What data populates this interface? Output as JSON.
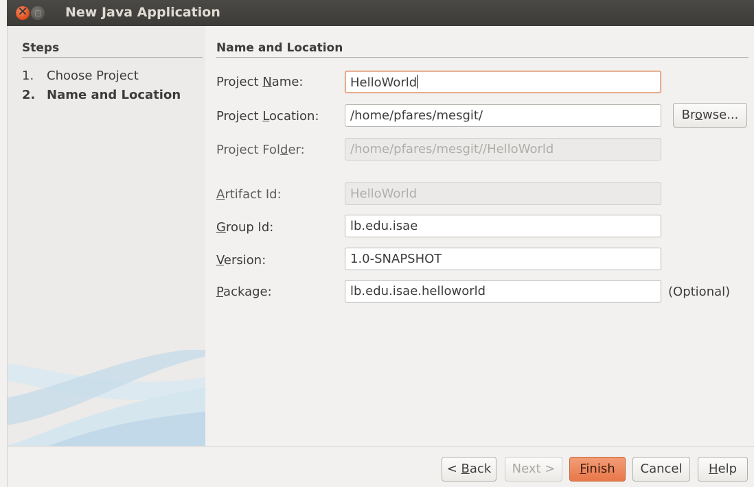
{
  "window": {
    "title": "New Java Application"
  },
  "steps": {
    "title": "Steps",
    "items": [
      {
        "num": "1.",
        "label": "Choose Project"
      },
      {
        "num": "2.",
        "label": "Name and Location"
      }
    ]
  },
  "section": {
    "title": "Name and Location"
  },
  "form": {
    "project_name": {
      "label_pre": "Project ",
      "label_key": "N",
      "label_post": "ame:",
      "value": "HelloWorld"
    },
    "project_location": {
      "label_pre": "Project ",
      "label_key": "L",
      "label_post": "ocation:",
      "value": "/home/pfares/mesgit/"
    },
    "project_folder": {
      "label_pre": "Project Fol",
      "label_key": "d",
      "label_post": "er:",
      "value": "/home/pfares/mesgit//HelloWorld"
    },
    "artifact_id": {
      "label_pre": "",
      "label_key": "A",
      "label_post": "rtifact Id:",
      "value": "HelloWorld"
    },
    "group_id": {
      "label_pre": "",
      "label_key": "G",
      "label_post": "roup Id:",
      "value": "lb.edu.isae"
    },
    "version": {
      "label_pre": "",
      "label_key": "V",
      "label_post": "ersion:",
      "value": "1.0-SNAPSHOT"
    },
    "package": {
      "label_pre": "",
      "label_key": "P",
      "label_post": "ackage:",
      "value": "lb.edu.isae.helloworld"
    },
    "optional_text": "(Optional)"
  },
  "buttons": {
    "browse": {
      "pre": "Br",
      "key": "o",
      "post": "wse..."
    },
    "back": {
      "pre": "< ",
      "key": "B",
      "post": "ack"
    },
    "next": "Next >",
    "finish": {
      "pre": "",
      "key": "F",
      "post": "inish"
    },
    "cancel": "Cancel",
    "help": {
      "pre": "",
      "key": "H",
      "post": "elp"
    }
  }
}
